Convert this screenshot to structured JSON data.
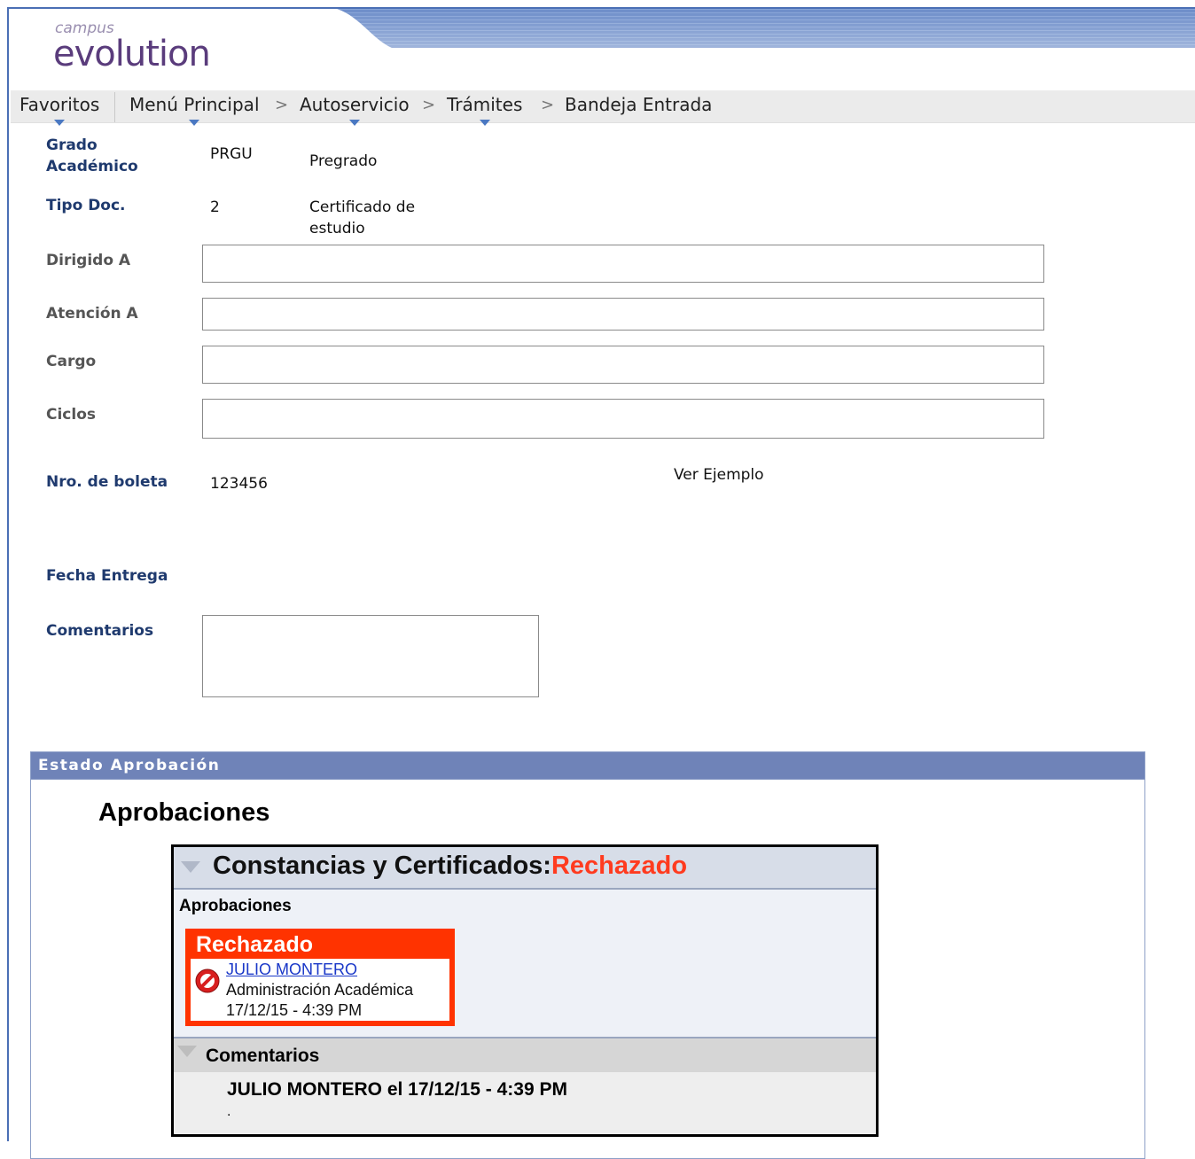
{
  "logo": {
    "small": "campus",
    "big": "evolution"
  },
  "nav": {
    "items": [
      {
        "label": "Favoritos"
      },
      {
        "label": "Menú Principal"
      },
      {
        "label": "Autoservicio"
      },
      {
        "label": "Trámites"
      },
      {
        "label": "Bandeja Entrada"
      }
    ],
    "separator": ">"
  },
  "form": {
    "grado_label": "Grado Académico",
    "grado_code": "PRGU",
    "grado_desc": "Pregrado",
    "tipo_label": "Tipo Doc.",
    "tipo_code": "2",
    "tipo_desc": "Certificado de estudio",
    "dirigido_label": "Dirigido A",
    "dirigido_value": "",
    "atencion_label": "Atención A",
    "atencion_value": "",
    "cargo_label": "Cargo",
    "cargo_value": "",
    "ciclos_label": "Ciclos",
    "ciclos_value": "",
    "boleta_label": "Nro. de boleta",
    "boleta_value": "123456",
    "ver_ejemplo": "Ver Ejemplo",
    "fecha_label": "Fecha Entrega",
    "comentarios_label": "Comentarios",
    "comentarios_value": ""
  },
  "estado": {
    "header": "Estado Aprobación",
    "title": "Aprobaciones",
    "box_title": "Constancias y Certificados:",
    "box_status": "Rechazado",
    "sub_title": "Aprobaciones",
    "card": {
      "status": "Rechazado",
      "name": "JULIO MONTERO",
      "dept": "Administración Académica",
      "date": "17/12/15 - 4:39 PM"
    },
    "comments": {
      "title": "Comentarios",
      "author": "JULIO MONTERO el 17/12/15 - 4:39 PM",
      "text": "."
    }
  },
  "colors": {
    "accent": "#4a6fb5",
    "label": "#1f3a6e",
    "rejected": "#ff3300",
    "section_header": "#6f83b8"
  }
}
